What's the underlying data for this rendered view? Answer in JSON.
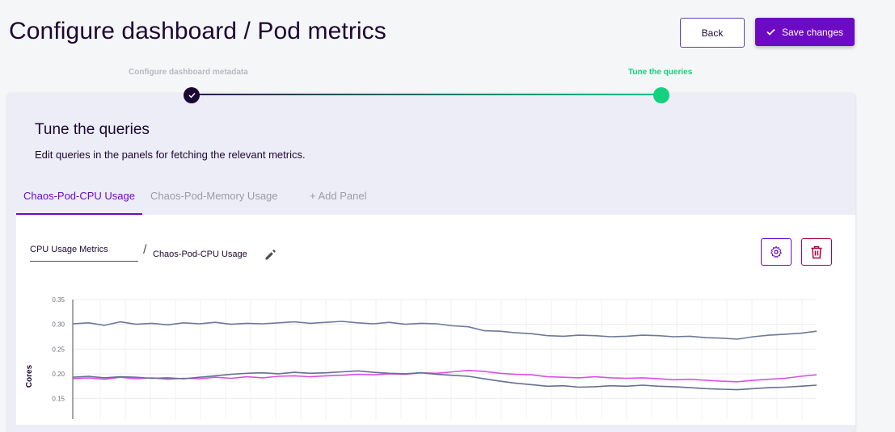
{
  "header": {
    "title": "Configure dashboard / Pod metrics",
    "back_label": "Back",
    "save_label": "Save changes"
  },
  "stepper": {
    "steps": [
      {
        "label": "Configure dashboard metadata",
        "state": "completed"
      },
      {
        "label": "Tune the queries",
        "state": "active"
      }
    ],
    "active_color": "#13d17c"
  },
  "card": {
    "title": "Tune the queries",
    "description": "Edit queries in the panels for fetching the relevant metrics."
  },
  "tabs": [
    {
      "label": "Chaos-Pod-CPU Usage",
      "active": true
    },
    {
      "label": "Chaos-Pod-Memory Usage",
      "active": false
    },
    {
      "label": "+ Add Panel",
      "active": false
    }
  ],
  "panel": {
    "group_value": "CPU Usage Metrics",
    "separator": "/",
    "name": "Chaos-Pod-CPU Usage",
    "icons": [
      "pencil-icon",
      "gear-icon",
      "trash-icon"
    ]
  },
  "colors": {
    "brand": "#6c0bc3",
    "danger": "#b2003b",
    "text": "#1c0732"
  },
  "chart_data": {
    "type": "line",
    "ylabel": "Cores",
    "ylim": [
      0.13,
      0.35
    ],
    "yticks": [
      "0.35",
      "0.30",
      "0.25",
      "0.20",
      "0.15"
    ],
    "grid": true,
    "series": [
      {
        "color": "#6b7899",
        "values": [
          0.301,
          0.303,
          0.298,
          0.305,
          0.3,
          0.302,
          0.299,
          0.303,
          0.301,
          0.304,
          0.3,
          0.302,
          0.301,
          0.303,
          0.305,
          0.302,
          0.304,
          0.306,
          0.303,
          0.301,
          0.304,
          0.3,
          0.302,
          0.301,
          0.297,
          0.295,
          0.287,
          0.286,
          0.283,
          0.281,
          0.277,
          0.276,
          0.278,
          0.277,
          0.275,
          0.276,
          0.278,
          0.277,
          0.275,
          0.276,
          0.273,
          0.272,
          0.27,
          0.275,
          0.278,
          0.28,
          0.282,
          0.286
        ]
      },
      {
        "color": "#d94fe6",
        "values": [
          0.19,
          0.192,
          0.189,
          0.193,
          0.19,
          0.192,
          0.189,
          0.191,
          0.19,
          0.193,
          0.191,
          0.194,
          0.192,
          0.195,
          0.196,
          0.194,
          0.196,
          0.197,
          0.199,
          0.198,
          0.2,
          0.199,
          0.202,
          0.201,
          0.204,
          0.207,
          0.205,
          0.201,
          0.199,
          0.198,
          0.194,
          0.193,
          0.192,
          0.194,
          0.192,
          0.191,
          0.192,
          0.19,
          0.188,
          0.189,
          0.187,
          0.185,
          0.184,
          0.187,
          0.189,
          0.191,
          0.195,
          0.198
        ]
      },
      {
        "color": "#65708f",
        "values": [
          0.193,
          0.195,
          0.192,
          0.194,
          0.193,
          0.191,
          0.192,
          0.19,
          0.193,
          0.196,
          0.199,
          0.201,
          0.202,
          0.2,
          0.203,
          0.201,
          0.202,
          0.204,
          0.206,
          0.203,
          0.201,
          0.2,
          0.202,
          0.199,
          0.197,
          0.195,
          0.19,
          0.185,
          0.181,
          0.178,
          0.175,
          0.176,
          0.173,
          0.174,
          0.176,
          0.175,
          0.177,
          0.175,
          0.174,
          0.172,
          0.17,
          0.169,
          0.168,
          0.17,
          0.172,
          0.173,
          0.175,
          0.177
        ]
      }
    ]
  }
}
